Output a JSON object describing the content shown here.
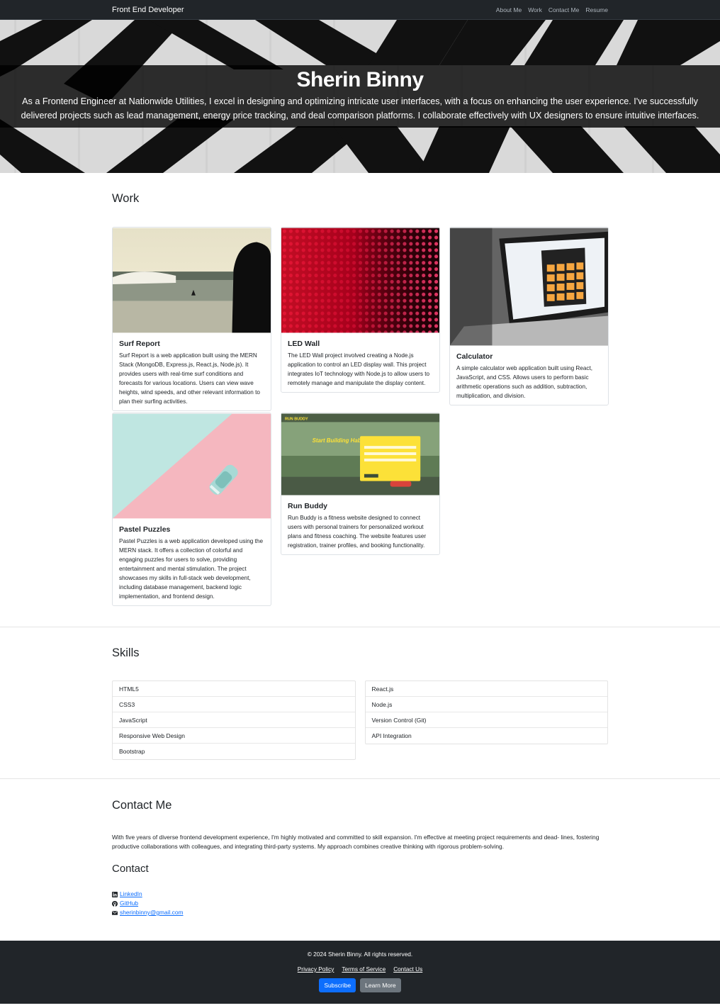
{
  "nav": {
    "brand": "Front End Developer",
    "links": [
      "About Me",
      "Work",
      "Contact Me",
      "Resume"
    ]
  },
  "hero": {
    "name": "Sherin Binny",
    "bio": "As a Frontend Engineer at Nationwide Utilities, I excel in designing and optimizing intricate user interfaces, with a focus on enhancing the user experience. I've successfully delivered projects such as lead management, energy price tracking, and deal comparison platforms. I collaborate effectively with UX designers to ensure intuitive interfaces."
  },
  "work": {
    "title": "Work",
    "projects": [
      {
        "title": "Surf Report",
        "description": "Surf Report is a web application built using the MERN Stack (MongoDB, Express.js, React.js, Node.js). It provides users with real-time surf conditions and forecasts for various locations. Users can view wave heights, wind speeds, and other relevant information to plan their surfing activities."
      },
      {
        "title": "LED Wall",
        "description": "The LED Wall project involved creating a Node.js application to control an LED display wall. This project integrates IoT technology with Node.js to allow users to remotely manage and manipulate the display content."
      },
      {
        "title": "Calculator",
        "description": "A simple calculator web application built using React, JavaScript, and CSS. Allows users to perform basic arithmetic operations such as addition, subtraction, multiplication, and division."
      },
      {
        "title": "Pastel Puzzles",
        "description": "Pastel Puzzles is a web application developed using the MERN stack. It offers a collection of colorful and engaging puzzles for users to solve, providing entertainment and mental stimulation. The project showcases my skills in full-stack web development, including database management, backend logic implementation, and frontend design."
      },
      {
        "title": "Run Buddy",
        "description": "Run Buddy is a fitness website designed to connect users with personal trainers for personalized workout plans and fitness coaching. The website features user registration, trainer profiles, and booking functionality."
      }
    ],
    "run_buddy_logo": "RUN BUDDY",
    "run_buddy_tagline": "Start Building Habits."
  },
  "skills": {
    "title": "Skills",
    "left": [
      "HTML5",
      "CSS3",
      "JavaScript",
      "Responsive Web Design",
      "Bootstrap"
    ],
    "right": [
      "React.js",
      "Node.js",
      "Version Control (Git)",
      "API Integration"
    ]
  },
  "contact": {
    "title": "Contact Me",
    "text": "With five years of diverse frontend development experience, I'm highly motivated and committed to skill expansion. I'm effective at meeting project requirements and dead- lines, fostering productive collaborations with colleagues, and integrating third-party systems. My approach combines creative thinking with rigorous problem-solving.",
    "subtitle": "Contact",
    "linkedin": "LinkedIn",
    "github": "GitHub",
    "email": "sherinbinny@gmail.com"
  },
  "footer": {
    "copyright": "© 2024 Sherin Binny. All rights reserved.",
    "links": [
      "Privacy Policy",
      "Terms of Service",
      "Contact Us"
    ],
    "subscribe": "Subscribe",
    "learn_more": "Learn More"
  },
  "colors": {
    "navbar": "#212529",
    "primary": "#0d6efd",
    "secondary": "#6c757d"
  }
}
